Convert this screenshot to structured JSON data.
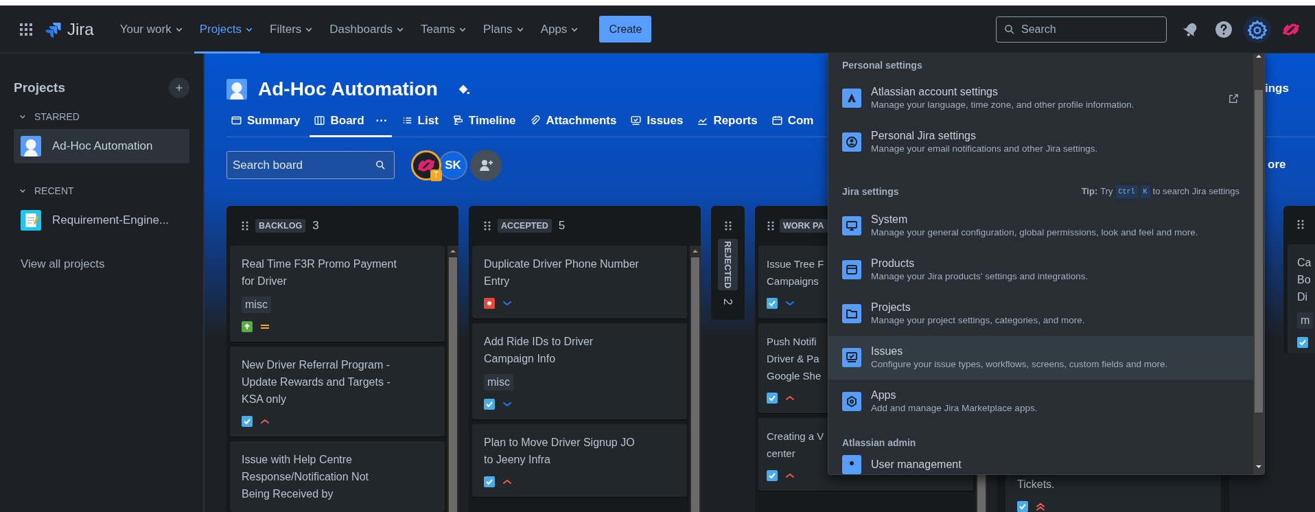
{
  "nav": {
    "items": [
      {
        "label": "Your work",
        "selected": false
      },
      {
        "label": "Projects",
        "selected": true
      },
      {
        "label": "Filters",
        "selected": false
      },
      {
        "label": "Dashboards",
        "selected": false
      },
      {
        "label": "Teams",
        "selected": false
      },
      {
        "label": "Plans",
        "selected": false
      },
      {
        "label": "Apps",
        "selected": false
      }
    ],
    "product": "Jira",
    "create": "Create",
    "search_placeholder": "Search"
  },
  "sidebar": {
    "title": "Projects",
    "sections": [
      {
        "label": "STARRED",
        "items": [
          {
            "label": "Ad-Hoc Automation",
            "selected": true,
            "kind": "figure"
          }
        ]
      },
      {
        "label": "RECENT",
        "items": [
          {
            "label": "Requirement-Engine...",
            "selected": false,
            "kind": "notes"
          }
        ]
      }
    ],
    "footer_link": "View all projects"
  },
  "project": {
    "title": "Ad-Hoc Automation",
    "tabs": [
      {
        "label": "Summary",
        "selected": false
      },
      {
        "label": "Board",
        "selected": true,
        "more": "···"
      },
      {
        "label": "List",
        "selected": false
      },
      {
        "label": "Timeline",
        "selected": false
      },
      {
        "label": "Attachments",
        "selected": false
      },
      {
        "label": "Issues",
        "selected": false
      },
      {
        "label": "Reports",
        "selected": false
      },
      {
        "label": "Com",
        "selected": false
      }
    ],
    "search_placeholder": "Search board",
    "avatars": [
      {
        "kind": "logo",
        "badge": "T"
      },
      {
        "kind": "initials",
        "text": "SK"
      },
      {
        "kind": "add"
      }
    ],
    "partial_texts": [
      "ings",
      "ore"
    ]
  },
  "columns": [
    {
      "kind": "expanded",
      "title": "BACKLOG",
      "count": "3",
      "cards": [
        {
          "title": "Real Time F3R Promo Payment for Driver",
          "tag": "misc",
          "icons": [
            {
              "kind": "improvement"
            },
            {
              "kind": "medium"
            }
          ]
        },
        {
          "title": "New Driver Referral Program - Update Rewards and Targets - KSA only",
          "icons": [
            {
              "kind": "task"
            },
            {
              "kind": "high"
            }
          ]
        },
        {
          "title": "Issue with Help Centre Response/Notification Not Being Received by"
        }
      ]
    },
    {
      "kind": "expanded",
      "title": "ACCEPTED",
      "count": "5",
      "cards": [
        {
          "title": "Duplicate Driver Phone Number Entry",
          "icons": [
            {
              "kind": "bug"
            },
            {
              "kind": "low"
            }
          ]
        },
        {
          "title": "Add Ride IDs to Driver Campaign Info",
          "tag": "misc",
          "icons": [
            {
              "kind": "task"
            },
            {
              "kind": "low"
            }
          ]
        },
        {
          "title": "Plan to Move Driver Signup JO to Jeeny Infra",
          "icons": [
            {
              "kind": "task"
            },
            {
              "kind": "high"
            }
          ]
        }
      ]
    },
    {
      "kind": "collapsed",
      "title": "REJECTED",
      "count": "2"
    },
    {
      "kind": "partial",
      "title": "WORK PA",
      "cards": [
        {
          "lines": [
            "Issue Tree F",
            "Campaigns"
          ],
          "icons": [
            {
              "kind": "task"
            },
            {
              "kind": "low"
            }
          ]
        },
        {
          "lines": [
            "Push Notifi",
            "Driver & Pa",
            "Google She"
          ],
          "icons": [
            {
              "kind": "task"
            },
            {
              "kind": "high"
            }
          ]
        },
        {
          "lines": [
            "Creating a V",
            "center"
          ],
          "icons": [
            {
              "kind": "task"
            },
            {
              "kind": "high"
            }
          ]
        }
      ]
    },
    {
      "kind": "hidden",
      "cards": [
        {
          "lines": [
            "Tickets."
          ],
          "icons": [
            {
              "kind": "task"
            },
            {
              "kind": "highest"
            }
          ]
        }
      ]
    },
    {
      "kind": "edge",
      "cards": [
        {
          "lines": [
            "Ca",
            "Bo",
            "Di"
          ],
          "tag": "m",
          "icons": [
            {
              "kind": "task"
            }
          ]
        }
      ]
    }
  ],
  "settings_menu": {
    "sections": [
      {
        "heading": "Personal settings",
        "items": [
          {
            "title": "Atlassian account settings",
            "description": "Manage your language, time zone, and other profile information.",
            "kind": "external",
            "selected": false
          },
          {
            "title": "Personal Jira settings",
            "description": "Manage your email notifications and other Jira settings.",
            "kind": "page",
            "selected": false
          }
        ]
      },
      {
        "heading": "Jira settings",
        "tip": {
          "label": "Tip:",
          "lead": "Try",
          "keys": [
            "Ctrl",
            "K"
          ],
          "trail": "to search Jira settings"
        },
        "items": [
          {
            "title": "System",
            "description": "Manage your general configuration, global permissions, look and feel and more.",
            "kind": "page",
            "selected": false
          },
          {
            "title": "Products",
            "description": "Manage your Jira products' settings and integrations.",
            "kind": "page",
            "selected": false
          },
          {
            "title": "Projects",
            "description": "Manage your project settings, categories, and more.",
            "kind": "page",
            "selected": false
          },
          {
            "title": "Issues",
            "description": "Configure your issue types, workflows, screens, custom fields and more.",
            "kind": "page",
            "selected": true
          },
          {
            "title": "Apps",
            "description": "Add and manage Jira Marketplace apps.",
            "kind": "page",
            "selected": false
          }
        ]
      },
      {
        "heading": "Atlassian admin",
        "items": [
          {
            "title": "User management",
            "kind": "page",
            "selected": false
          }
        ]
      }
    ]
  }
}
